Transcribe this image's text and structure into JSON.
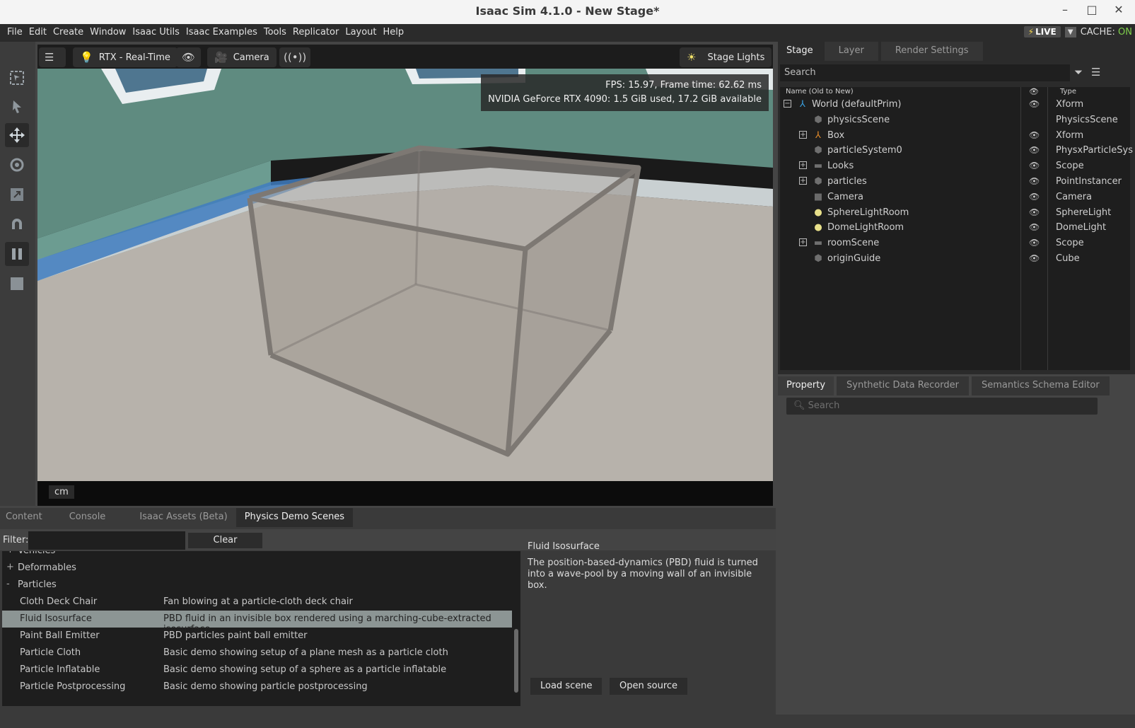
{
  "window": {
    "title": "Isaac Sim 4.1.0 - New Stage*",
    "minimize_glyph": "–",
    "maximize_glyph": "□",
    "close_glyph": "✕"
  },
  "menu": {
    "items": [
      "File",
      "Edit",
      "Create",
      "Window",
      "Isaac Utils",
      "Isaac Examples",
      "Tools",
      "Replicator",
      "Layout",
      "Help"
    ],
    "live_label": "LIVE",
    "cache_label": "CACHE:",
    "cache_state": "ON"
  },
  "viewport": {
    "renderer_label": "RTX - Real-Time",
    "camera_label": "Camera",
    "lights_label": "Stage Lights",
    "fps_text": "FPS: 15.97, Frame time: 62.62 ms",
    "gpu_text": "NVIDIA GeForce RTX 4090: 1.5 GiB used, 17.2 GiB available",
    "unit_label": "cm"
  },
  "stage": {
    "tabs": [
      "Stage",
      "Layer",
      "Render Settings"
    ],
    "search_placeholder": "Search",
    "col_name": "Name (Old to New)",
    "col_type": "Type",
    "rows": [
      {
        "name": "World (defaultPrim)",
        "type": "Xform",
        "icon": "xform-icon",
        "expand": "−",
        "visible": true
      },
      {
        "name": "physicsScene",
        "type": "PhysicsScene",
        "icon": "prim-icon",
        "expand": "",
        "visible": false
      },
      {
        "name": "Box",
        "type": "Xform",
        "icon": "xform-orange-icon",
        "expand": "+",
        "visible": true
      },
      {
        "name": "particleSystem0",
        "type": "PhysxParticleSys",
        "icon": "prim-icon",
        "expand": "",
        "visible": true
      },
      {
        "name": "Looks",
        "type": "Scope",
        "icon": "folder-icon",
        "expand": "+",
        "visible": true
      },
      {
        "name": "particles",
        "type": "PointInstancer",
        "icon": "prim-icon",
        "expand": "+",
        "visible": true
      },
      {
        "name": "Camera",
        "type": "Camera",
        "icon": "camera-icon",
        "expand": "",
        "visible": true
      },
      {
        "name": "SphereLightRoom",
        "type": "SphereLight",
        "icon": "light-icon",
        "expand": "",
        "visible": true
      },
      {
        "name": "DomeLightRoom",
        "type": "DomeLight",
        "icon": "light-icon",
        "expand": "",
        "visible": true
      },
      {
        "name": "roomScene",
        "type": "Scope",
        "icon": "folder-icon",
        "expand": "+",
        "visible": true
      },
      {
        "name": "originGuide",
        "type": "Cube",
        "icon": "prim-icon",
        "expand": "",
        "visible": true
      }
    ]
  },
  "property": {
    "tabs": [
      "Property",
      "Synthetic Data Recorder",
      "Semantics Schema Editor"
    ],
    "search_placeholder": "Search"
  },
  "bottom": {
    "tabs": [
      "Content",
      "Console",
      "Isaac Assets (Beta)",
      "Physics Demo Scenes"
    ],
    "filter_label": "Filter:",
    "clear_label": "Clear",
    "groups": [
      {
        "label": "Vehicles",
        "toggle": "+"
      },
      {
        "label": "Deformables",
        "toggle": "+"
      },
      {
        "label": "Particles",
        "toggle": "-"
      }
    ],
    "demos": [
      {
        "name": "Cloth Deck Chair",
        "desc": "Fan blowing at a particle-cloth deck chair"
      },
      {
        "name": "Fluid Isosurface",
        "desc": "PBD fluid in an invisible box rendered using a marching-cube-extracted isosurface",
        "selected": true
      },
      {
        "name": "Paint Ball Emitter",
        "desc": "PBD particles paint ball emitter"
      },
      {
        "name": "Particle Cloth",
        "desc": "Basic demo showing setup of a plane mesh as a particle cloth"
      },
      {
        "name": "Particle Inflatable",
        "desc": "Basic demo showing setup of a sphere as a particle inflatable"
      },
      {
        "name": "Particle Postprocessing",
        "desc": "Basic demo showing particle postprocessing"
      }
    ],
    "detail_title": "Fluid Isosurface",
    "detail_body": "The position-based-dynamics (PBD) fluid is turned into a wave-pool by a moving wall of an invisible box.",
    "load_label": "Load scene",
    "open_label": "Open source"
  }
}
